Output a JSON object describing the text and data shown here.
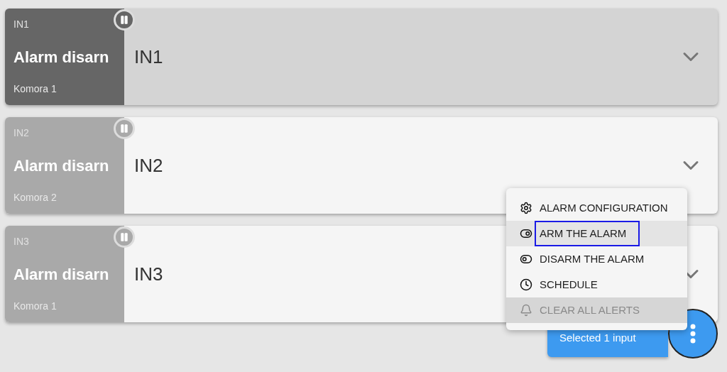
{
  "inputs": [
    {
      "code": "IN1",
      "status": "Alarm disarn",
      "location": "Komora 1",
      "name": "IN1",
      "selected": true
    },
    {
      "code": "IN2",
      "status": "Alarm disarn",
      "location": "Komora 2",
      "name": "IN2",
      "selected": false
    },
    {
      "code": "IN3",
      "status": "Alarm disarn",
      "location": "Komora 1",
      "name": "IN3",
      "selected": false
    }
  ],
  "menu": [
    {
      "label": "ALARM CONFIGURATION",
      "selected": false,
      "disabled": false
    },
    {
      "label": "ARM THE ALARM",
      "selected": true,
      "disabled": false
    },
    {
      "label": "DISARM THE ALARM",
      "selected": false,
      "disabled": false
    },
    {
      "label": "SCHEDULE",
      "selected": false,
      "disabled": false
    },
    {
      "label": "CLEAR ALL ALERTS",
      "selected": false,
      "disabled": true
    }
  ],
  "selection_label": "Selected 1 input"
}
